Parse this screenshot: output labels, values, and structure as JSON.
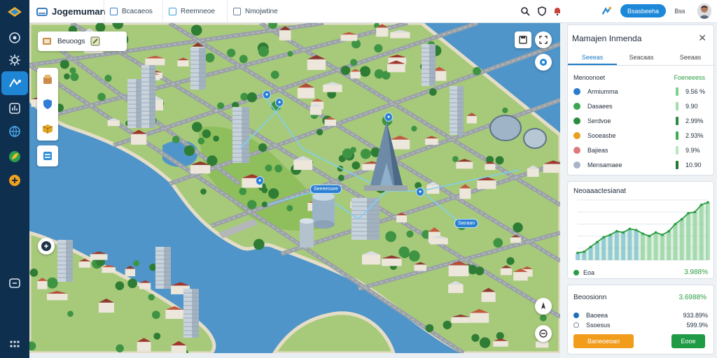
{
  "app": {
    "title": "Jogemuman"
  },
  "topbar": {
    "tabs": [
      {
        "label": "Bcacaeos",
        "icon": "document-icon"
      },
      {
        "label": "Reemneoe",
        "icon": "image-icon"
      },
      {
        "label": "Nmojwtine",
        "icon": "grid-icon"
      }
    ],
    "action_label": "Bsasbeeha",
    "extra_label": "Bss"
  },
  "map": {
    "search_label": "Beuoogs",
    "pins": [
      "Seeeessee",
      "Saoaan"
    ]
  },
  "panel": {
    "title": "Mamajen Inmenda",
    "tabs": [
      "Seeeas",
      "Seacaas",
      "Seeaas"
    ],
    "list_header": {
      "label": "Menoonoet",
      "value": "Foeneeess"
    },
    "rows": [
      {
        "label": "Armiumma",
        "value": "9.56 %",
        "dot": "#2c7ccc",
        "bar": "#7ad38c",
        "icon": "person-icon"
      },
      {
        "label": "Dasaees",
        "value": "9.90",
        "dot": "#3aa652",
        "bar": "#9fdfa9",
        "icon": "leaf-icon"
      },
      {
        "label": "Serdvoe",
        "value": "2.99%",
        "dot": "#2c8c3e",
        "bar": "#2c8c3e",
        "icon": "clock-icon"
      },
      {
        "label": "Sooeasbe",
        "value": "2.93%",
        "dot": "#e8a11c",
        "bar": "#3ab056",
        "icon": "coin-icon"
      },
      {
        "label": "Bajieas",
        "value": "9.9%",
        "dot": "#e07a7a",
        "bar": "#b7e6bf",
        "icon": "flag-icon"
      },
      {
        "label": "Mensamaee",
        "value": "10.90",
        "dot": "#a8b4c8",
        "bar": "#1f7a34",
        "icon": "cloud-icon"
      }
    ],
    "chart_card": {
      "title": "Neoaaactesianat",
      "legend_label": "Eoa",
      "legend_value": "3.988%"
    },
    "summary": {
      "title": "Beoosionn",
      "title_value": "3.6988%",
      "rows": [
        {
          "label": "Baoeea",
          "value": "933.89%",
          "dot": "#1d6fb8"
        },
        {
          "label": "Ssoesus",
          "value": "599.9%",
          "dot": "#7a8a9a"
        }
      ]
    },
    "buttons": {
      "primary": "Baneoeoan",
      "secondary": "Eooe"
    }
  },
  "chart_data": {
    "type": "area",
    "title": "Neoaaactesianat",
    "xlabel": "",
    "ylabel": "",
    "ylim": [
      0,
      100
    ],
    "series": [
      {
        "values": [
          12,
          14,
          22,
          30,
          38,
          42,
          48,
          46,
          52,
          50,
          44,
          40,
          46,
          42,
          48,
          60,
          68,
          78,
          80,
          92,
          96
        ]
      }
    ],
    "grid": true,
    "legend": "bottom-left"
  },
  "colors": {
    "rail": "#0f2f4f",
    "accent": "#1d87d8",
    "water": "#4f95c9",
    "grass": "#93c16a",
    "road": "#9aa1a7"
  }
}
